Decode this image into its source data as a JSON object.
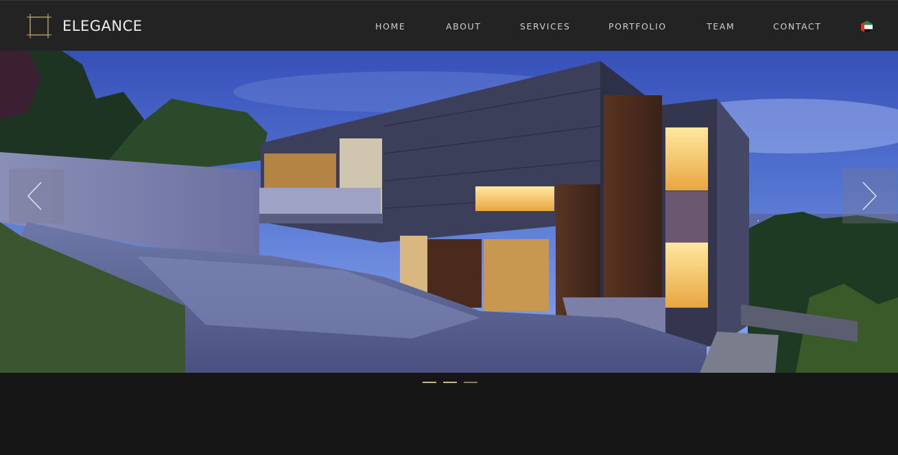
{
  "brand": {
    "name": "ELEGANCE",
    "logo_icon": "frame-logo-icon",
    "accent_color": "#b69a64"
  },
  "nav": {
    "items": [
      {
        "label": "HOME"
      },
      {
        "label": "ABOUT"
      },
      {
        "label": "SERVICES"
      },
      {
        "label": "PORTFOLIO"
      },
      {
        "label": "TEAM"
      },
      {
        "label": "CONTACT"
      }
    ],
    "language_icon": "uae-flag-icon"
  },
  "slider": {
    "image": "modern-house-at-dusk",
    "prev_icon": "chevron-left-icon",
    "next_icon": "chevron-right-icon",
    "slide_count": 3,
    "active_slide": 1
  },
  "colors": {
    "header_bg": "#232323",
    "page_bg": "#161616",
    "nav_text": "#cfcfcf",
    "dot_color": "#c8b88a"
  }
}
